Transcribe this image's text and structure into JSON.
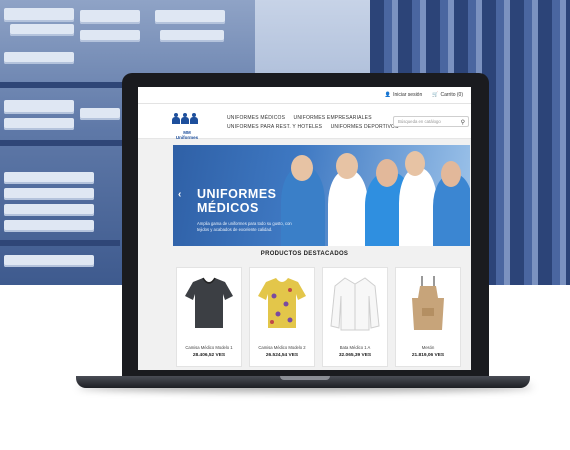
{
  "topbar": {
    "login_label": "Iniciar sesión",
    "cart_label": "Carrito (0)"
  },
  "brand": {
    "logo_text": "MM Uniformes"
  },
  "nav": {
    "items": [
      {
        "label": "UNIFORMES MÉDICOS"
      },
      {
        "label": "UNIFORMES EMPRESARIALES"
      },
      {
        "label": "UNIFORMES PARA REST. Y HOTELES"
      },
      {
        "label": "UNIFORMES DEPORTIVOS"
      }
    ]
  },
  "search": {
    "placeholder": "Búsqueda en catálogo"
  },
  "hero": {
    "title_line1": "UNIFORMES",
    "title_line2": "MÉDICOS",
    "subtitle": "Amplia gama de uniformes para todo su gusto, con tejidos y acabados de excelente calidad."
  },
  "featured": {
    "heading": "PRODUCTOS DESTACADOS"
  },
  "products": [
    {
      "name": "Camisa Médico Modelo 1",
      "price": "28.406,52 VES",
      "icon": "scrub-top-dark-icon",
      "color": "#3c3f44"
    },
    {
      "name": "Camisa Médico Modelo 2",
      "price": "26.524,54 VES",
      "icon": "scrub-top-pattern-icon",
      "color": "#e3c64a"
    },
    {
      "name": "Bata Médico 1 A",
      "price": "32.065,39 VES",
      "icon": "lab-coat-icon",
      "color": "#f7f7f7"
    },
    {
      "name": "Mesón",
      "price": "21.819,06 VES",
      "icon": "apron-icon",
      "color": "#c7a47a"
    }
  ]
}
